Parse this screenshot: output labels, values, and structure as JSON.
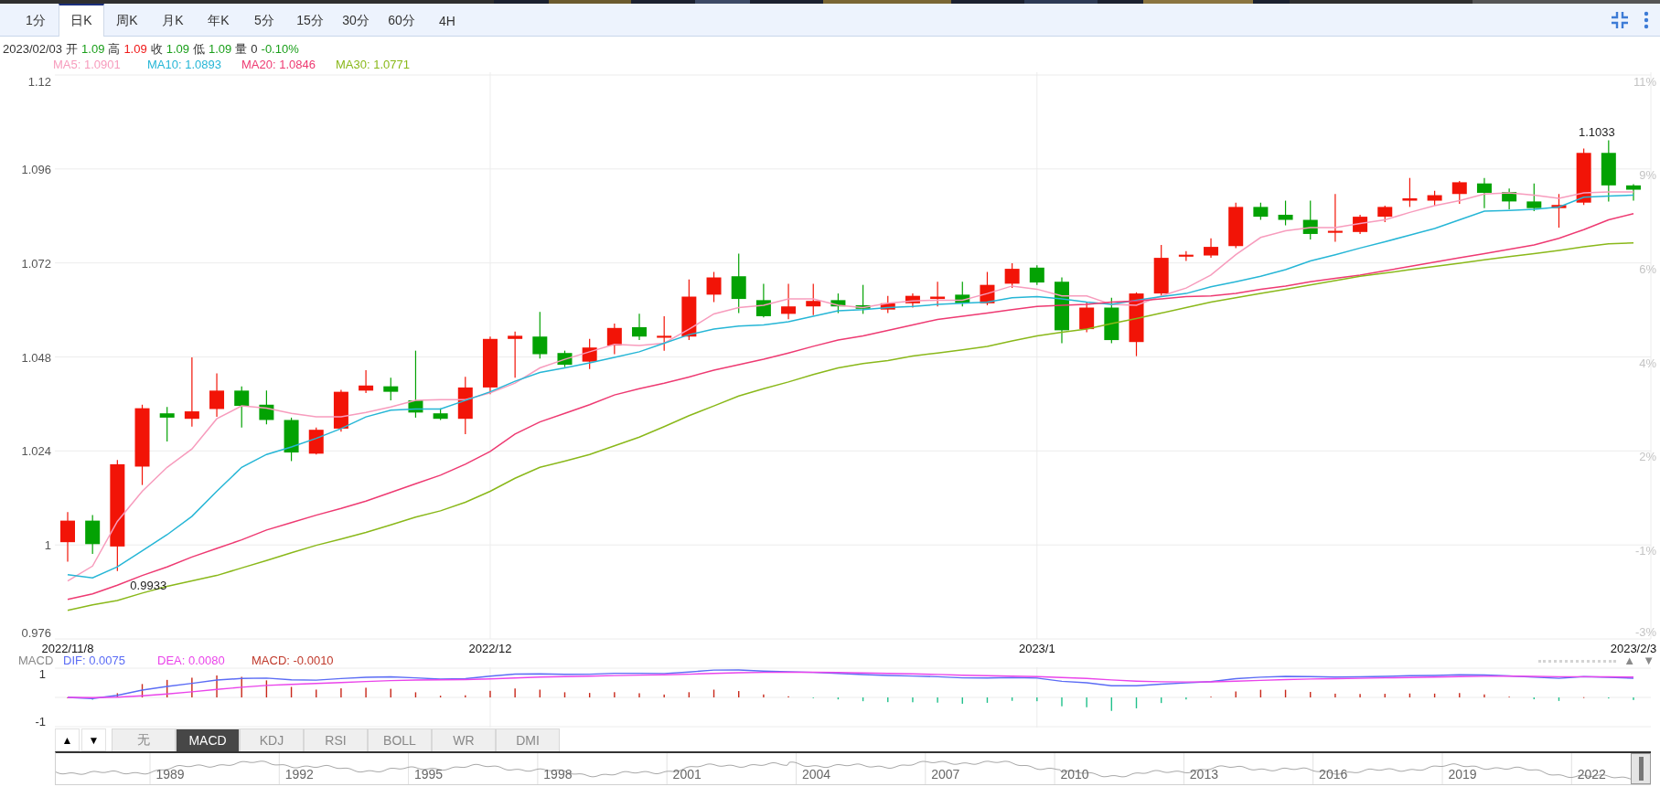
{
  "period_tabs": [
    {
      "label": "1分",
      "selected": false
    },
    {
      "label": "日K",
      "selected": true
    },
    {
      "label": "周K",
      "selected": false
    },
    {
      "label": "月K",
      "selected": false
    },
    {
      "label": "年K",
      "selected": false
    },
    {
      "label": "5分",
      "selected": false
    },
    {
      "label": "15分",
      "selected": false
    },
    {
      "label": "30分",
      "selected": false
    },
    {
      "label": "60分",
      "selected": false
    },
    {
      "label": "4H",
      "selected": false
    }
  ],
  "quote": {
    "date": "2023/02/03",
    "fields": [
      {
        "label": "开",
        "value": "1.09",
        "color": "#1a9f1a"
      },
      {
        "label": "高",
        "value": "1.09",
        "color": "#f01818"
      },
      {
        "label": "收",
        "value": "1.09",
        "color": "#1a9f1a"
      },
      {
        "label": "低",
        "value": "1.09",
        "color": "#1a9f1a"
      },
      {
        "label": "量",
        "value": "0",
        "color": "#333333"
      }
    ],
    "change": {
      "text": "-0.10%",
      "color": "#1a9f1a"
    }
  },
  "main_chart": {
    "percent_labels": [
      "11%",
      "9%",
      "6%",
      "4%",
      "2%",
      "-1%",
      "-3%"
    ],
    "chart_data": {
      "type": "candlestick",
      "grid": true,
      "categories": [
        "2022/11/8",
        null,
        null,
        null,
        null,
        null,
        null,
        null,
        null,
        null,
        null,
        null,
        null,
        null,
        null,
        null,
        null,
        "2022/12",
        null,
        null,
        null,
        null,
        null,
        null,
        null,
        null,
        null,
        null,
        null,
        null,
        null,
        null,
        null,
        null,
        null,
        null,
        null,
        null,
        null,
        "2023/1",
        null,
        null,
        null,
        null,
        null,
        null,
        null,
        null,
        null,
        null,
        null,
        null,
        null,
        null,
        null,
        null,
        null,
        null,
        null,
        null,
        null,
        null,
        null,
        "2023/2/3"
      ],
      "ylim": [
        0.976,
        1.12
      ],
      "yticks": [
        1.12,
        1.096,
        1.072,
        1.048,
        1.024,
        1,
        0.976
      ],
      "series": [
        {
          "name": "MA5: 1.0901",
          "type": "line",
          "color": "#f79cbd",
          "values": [
            0.9908,
            0.9946,
            1.006,
            1.0137,
            1.0198,
            1.0245,
            1.0322,
            1.0355,
            1.0349,
            1.0336,
            1.0327,
            1.0327,
            1.0338,
            1.0352,
            1.0369,
            1.0371,
            1.0371,
            1.0388,
            1.0413,
            1.0452,
            1.0474,
            1.0493,
            1.0512,
            1.0509,
            1.0515,
            1.0551,
            1.059,
            1.0606,
            1.0612,
            1.0628,
            1.0628,
            1.0612,
            1.0606,
            1.0617,
            1.0623,
            1.0625,
            1.0625,
            1.0642,
            1.0661,
            1.0653,
            1.0636,
            1.0636,
            1.0614,
            1.0612,
            1.0636,
            1.0656,
            1.0689,
            1.0741,
            1.0785,
            1.0802,
            1.081,
            1.081,
            1.0821,
            1.083,
            1.0849,
            1.0866,
            1.0879,
            1.0896,
            1.0899,
            1.0893,
            1.0885,
            1.0899,
            1.0901,
            1.0901
          ]
        },
        {
          "name": "MA10: 1.0893",
          "type": "line",
          "color": "#26b6d6",
          "values": [
            0.9924,
            0.9916,
            0.9944,
            0.9985,
            1.0026,
            1.0073,
            1.0137,
            1.0198,
            1.0231,
            1.025,
            1.0272,
            1.0297,
            1.0327,
            1.0344,
            1.0347,
            1.0347,
            1.0369,
            1.0391,
            1.0418,
            1.044,
            1.0452,
            1.0465,
            1.0479,
            1.0493,
            1.0515,
            1.0537,
            1.0551,
            1.0559,
            1.0562,
            1.057,
            1.0584,
            1.0598,
            1.0601,
            1.0606,
            1.0609,
            1.0614,
            1.0617,
            1.062,
            1.0631,
            1.0634,
            1.0628,
            1.062,
            1.0614,
            1.0625,
            1.0634,
            1.0642,
            1.0659,
            1.0672,
            1.0686,
            1.0703,
            1.0725,
            1.0741,
            1.0758,
            1.0774,
            1.0791,
            1.0808,
            1.083,
            1.0852,
            1.0854,
            1.0857,
            1.0863,
            1.0888,
            1.0891,
            1.0893
          ]
        },
        {
          "name": "MA20: 1.0846",
          "type": "line",
          "color": "#ee3a72",
          "values": [
            0.9861,
            0.9875,
            0.9897,
            0.9922,
            0.9944,
            0.9969,
            0.9991,
            1.0013,
            1.0038,
            1.0057,
            1.0076,
            1.0093,
            1.0112,
            1.0134,
            1.0156,
            1.0178,
            1.0206,
            1.0239,
            1.0283,
            1.0314,
            1.0336,
            1.0358,
            1.0383,
            1.0399,
            1.0413,
            1.0429,
            1.0446,
            1.046,
            1.0474,
            1.049,
            1.0507,
            1.0523,
            1.0534,
            1.0548,
            1.0562,
            1.0576,
            1.0584,
            1.0592,
            1.0601,
            1.0609,
            1.0612,
            1.0614,
            1.062,
            1.0623,
            1.0628,
            1.0634,
            1.0636,
            1.0642,
            1.0653,
            1.0661,
            1.0672,
            1.0681,
            1.0689,
            1.07,
            1.0711,
            1.0722,
            1.0733,
            1.0744,
            1.0755,
            1.0766,
            1.0783,
            1.0805,
            1.083,
            1.0846
          ]
        },
        {
          "name": "MA30: 1.0771",
          "type": "line",
          "color": "#8ab81a",
          "values": [
            0.9833,
            0.9847,
            0.9858,
            0.9877,
            0.9894,
            0.9908,
            0.9922,
            0.9941,
            0.996,
            0.998,
            0.9999,
            1.0015,
            1.0032,
            1.0051,
            1.0071,
            1.0087,
            1.0109,
            1.0137,
            1.017,
            1.0198,
            1.0214,
            1.0231,
            1.0253,
            1.0275,
            1.0302,
            1.033,
            1.0355,
            1.038,
            1.0399,
            1.0416,
            1.0435,
            1.0452,
            1.0463,
            1.0471,
            1.0482,
            1.049,
            1.0498,
            1.0507,
            1.0521,
            1.0534,
            1.0543,
            1.0551,
            1.0565,
            1.0578,
            1.0592,
            1.0606,
            1.062,
            1.0631,
            1.0642,
            1.0653,
            1.0664,
            1.0675,
            1.0686,
            1.0694,
            1.0703,
            1.0711,
            1.0719,
            1.0728,
            1.0736,
            1.0744,
            1.0752,
            1.0761,
            1.0769,
            1.0771
          ]
        }
      ],
      "ohlc": [
        [
          1.0007,
          1.0084,
          0.9957,
          1.0062
        ],
        [
          1.0062,
          1.0076,
          0.9977,
          1.0002
        ],
        [
          0.9996,
          1.0217,
          0.9933,
          1.0206
        ],
        [
          1.02,
          1.0358,
          1.0153,
          1.0349
        ],
        [
          1.0336,
          1.0352,
          1.0264,
          1.0325
        ],
        [
          1.0322,
          1.0479,
          1.0302,
          1.0341
        ],
        [
          1.0347,
          1.0438,
          1.0327,
          1.0394
        ],
        [
          1.0394,
          1.0405,
          1.03,
          1.0355
        ],
        [
          1.0358,
          1.0394,
          1.0308,
          1.0319
        ],
        [
          1.0319,
          1.0325,
          1.0214,
          1.0236
        ],
        [
          1.0233,
          1.03,
          1.0231,
          1.0294
        ],
        [
          1.0297,
          1.0396,
          1.0289,
          1.0391
        ],
        [
          1.0394,
          1.0446,
          1.0388,
          1.0407
        ],
        [
          1.0405,
          1.0427,
          1.0369,
          1.0391
        ],
        [
          1.0369,
          1.0496,
          1.0325,
          1.0338
        ],
        [
          1.0336,
          1.0349,
          1.0319,
          1.0322
        ],
        [
          1.0322,
          1.0429,
          1.0283,
          1.0402
        ],
        [
          1.0402,
          1.0532,
          1.0385,
          1.0526
        ],
        [
          1.0526,
          1.0545,
          1.0427,
          1.0534
        ],
        [
          1.0532,
          1.0595,
          1.0476,
          1.0487
        ],
        [
          1.049,
          1.0496,
          1.0454,
          1.046
        ],
        [
          1.0468,
          1.0526,
          1.0449,
          1.0504
        ],
        [
          1.0509,
          1.0565,
          1.0487,
          1.0554
        ],
        [
          1.0556,
          1.059,
          1.0523,
          1.0532
        ],
        [
          1.0529,
          1.0584,
          1.0496,
          1.0534
        ],
        [
          1.0532,
          1.0678,
          1.0523,
          1.0634
        ],
        [
          1.0639,
          1.0697,
          1.062,
          1.0683
        ],
        [
          1.0686,
          1.0744,
          1.0592,
          1.0628
        ],
        [
          1.0625,
          1.0667,
          1.0581,
          1.0584
        ],
        [
          1.059,
          1.0667,
          1.0576,
          1.0609
        ],
        [
          1.0609,
          1.0667,
          1.0587,
          1.0623
        ],
        [
          1.0625,
          1.0642,
          1.0592,
          1.0609
        ],
        [
          1.0612,
          1.0664,
          1.059,
          1.0603
        ],
        [
          1.0601,
          1.0636,
          1.0592,
          1.0617
        ],
        [
          1.0617,
          1.0642,
          1.0606,
          1.0636
        ],
        [
          1.0628,
          1.0672,
          1.0609,
          1.0634
        ],
        [
          1.0639,
          1.0672,
          1.0609,
          1.0617
        ],
        [
          1.0617,
          1.0697,
          1.0612,
          1.0664
        ],
        [
          1.0667,
          1.0719,
          1.0656,
          1.0705
        ],
        [
          1.0708,
          1.0714,
          1.0664,
          1.067
        ],
        [
          1.0672,
          1.0683,
          1.0515,
          1.0548
        ],
        [
          1.0551,
          1.062,
          1.0543,
          1.0606
        ],
        [
          1.0606,
          1.0631,
          1.0515,
          1.0523
        ],
        [
          1.0518,
          1.0645,
          1.0482,
          1.0642
        ],
        [
          1.0642,
          1.0766,
          1.0636,
          1.0733
        ],
        [
          1.0736,
          1.075,
          1.0725,
          1.0741
        ],
        [
          1.0739,
          1.0783,
          1.0733,
          1.0761
        ],
        [
          1.0763,
          1.0874,
          1.0758,
          1.0863
        ],
        [
          1.0863,
          1.0874,
          1.083,
          1.0838
        ],
        [
          1.0843,
          1.0879,
          1.0816,
          1.083
        ],
        [
          1.083,
          1.0879,
          1.078,
          1.0794
        ],
        [
          1.0797,
          1.0896,
          1.0774,
          1.0802
        ],
        [
          1.0799,
          1.0843,
          1.0794,
          1.0838
        ],
        [
          1.0838,
          1.0866,
          1.0824,
          1.0863
        ],
        [
          1.0879,
          1.0937,
          1.0863,
          1.0885
        ],
        [
          1.0879,
          1.0904,
          1.0866,
          1.0893
        ],
        [
          1.0896,
          1.0929,
          1.0871,
          1.0926
        ],
        [
          1.0923,
          1.0937,
          1.086,
          1.0899
        ],
        [
          1.0901,
          1.091,
          1.0857,
          1.0877
        ],
        [
          1.0877,
          1.0923,
          1.0852,
          1.086
        ],
        [
          1.086,
          1.0896,
          1.081,
          1.0868
        ],
        [
          1.0874,
          1.1012,
          1.0868,
          1.1001
        ],
        [
          1.1001,
          1.1033,
          1.0877,
          1.0918
        ],
        [
          1.0918,
          1.0921,
          1.0879,
          1.0907
        ]
      ],
      "annotations": [
        "0.9933",
        "1.1033"
      ]
    }
  },
  "macd": {
    "legend": [
      {
        "text": "MACD",
        "color": "#888888"
      },
      {
        "text": "DIF: 0.0075",
        "color": "#5b6cf5"
      },
      {
        "text": "DEA: 0.0080",
        "color": "#ea44ea"
      },
      {
        "text": "MACD: -0.0010",
        "color": "#c0392b"
      }
    ],
    "arrows": [
      "▲",
      "▼"
    ],
    "y_labels": [
      "1",
      "-1"
    ]
  },
  "indicator_buttons": [
    "▲",
    "▼"
  ],
  "indicator_tabs": [
    {
      "label": "无",
      "selected": false
    },
    {
      "label": "MACD",
      "selected": true
    },
    {
      "label": "KDJ",
      "selected": false
    },
    {
      "label": "RSI",
      "selected": false
    },
    {
      "label": "BOLL",
      "selected": false
    },
    {
      "label": "WR",
      "selected": false
    },
    {
      "label": "DMI",
      "selected": false
    }
  ],
  "navigator": {
    "years": [
      "1989",
      "1992",
      "1995",
      "1998",
      "2001",
      "2004",
      "2007",
      "2010",
      "2013",
      "2016",
      "2019",
      "2022"
    ]
  }
}
